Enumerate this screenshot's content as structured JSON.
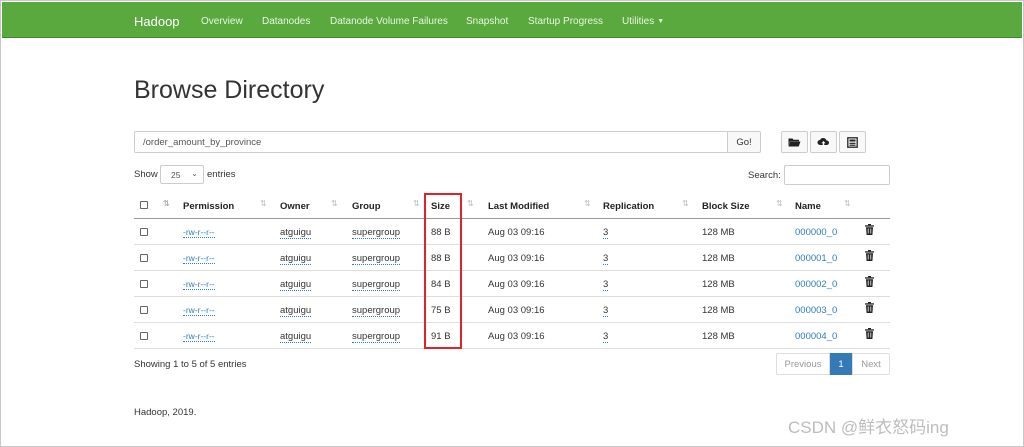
{
  "navbar": {
    "brand": "Hadoop",
    "items": [
      {
        "label": "Overview"
      },
      {
        "label": "Datanodes"
      },
      {
        "label": "Datanode Volume Failures"
      },
      {
        "label": "Snapshot"
      },
      {
        "label": "Startup Progress"
      },
      {
        "label": "Utilities"
      }
    ]
  },
  "page_title": "Browse Directory",
  "path": {
    "value": "/order_amount_by_province",
    "go_label": "Go!"
  },
  "toolbar": {
    "icons": [
      "folder-open-icon",
      "upload-cloud-icon",
      "cut-paste-icon"
    ]
  },
  "controls": {
    "show_label": "Show",
    "page_size": "25",
    "entries_label": "entries",
    "search_label": "Search:",
    "search_value": ""
  },
  "table": {
    "columns": [
      "Permission",
      "Owner",
      "Group",
      "Size",
      "Last Modified",
      "Replication",
      "Block Size",
      "Name"
    ],
    "rows": [
      {
        "permission": "-rw-r--r--",
        "owner": "atguigu",
        "group": "supergroup",
        "size": "88 B",
        "modified": "Aug 03 09:16",
        "replication": "3",
        "block_size": "128 MB",
        "name": "000000_0"
      },
      {
        "permission": "-rw-r--r--",
        "owner": "atguigu",
        "group": "supergroup",
        "size": "88 B",
        "modified": "Aug 03 09:16",
        "replication": "3",
        "block_size": "128 MB",
        "name": "000001_0"
      },
      {
        "permission": "-rw-r--r--",
        "owner": "atguigu",
        "group": "supergroup",
        "size": "84 B",
        "modified": "Aug 03 09:16",
        "replication": "3",
        "block_size": "128 MB",
        "name": "000002_0"
      },
      {
        "permission": "-rw-r--r--",
        "owner": "atguigu",
        "group": "supergroup",
        "size": "75 B",
        "modified": "Aug 03 09:16",
        "replication": "3",
        "block_size": "128 MB",
        "name": "000003_0"
      },
      {
        "permission": "-rw-r--r--",
        "owner": "atguigu",
        "group": "supergroup",
        "size": "91 B",
        "modified": "Aug 03 09:16",
        "replication": "3",
        "block_size": "128 MB",
        "name": "000004_0"
      }
    ]
  },
  "pagination": {
    "summary": "Showing 1 to 5 of 5 entries",
    "previous": "Previous",
    "current": "1",
    "next": "Next"
  },
  "footer": "Hadoop, 2019.",
  "watermark": "CSDN @鲜衣怒码ing",
  "colors": {
    "navbar": "#5aa93e",
    "link": "#2f7dc0",
    "highlight": "#e0222a",
    "page_active": "#337ab7"
  }
}
